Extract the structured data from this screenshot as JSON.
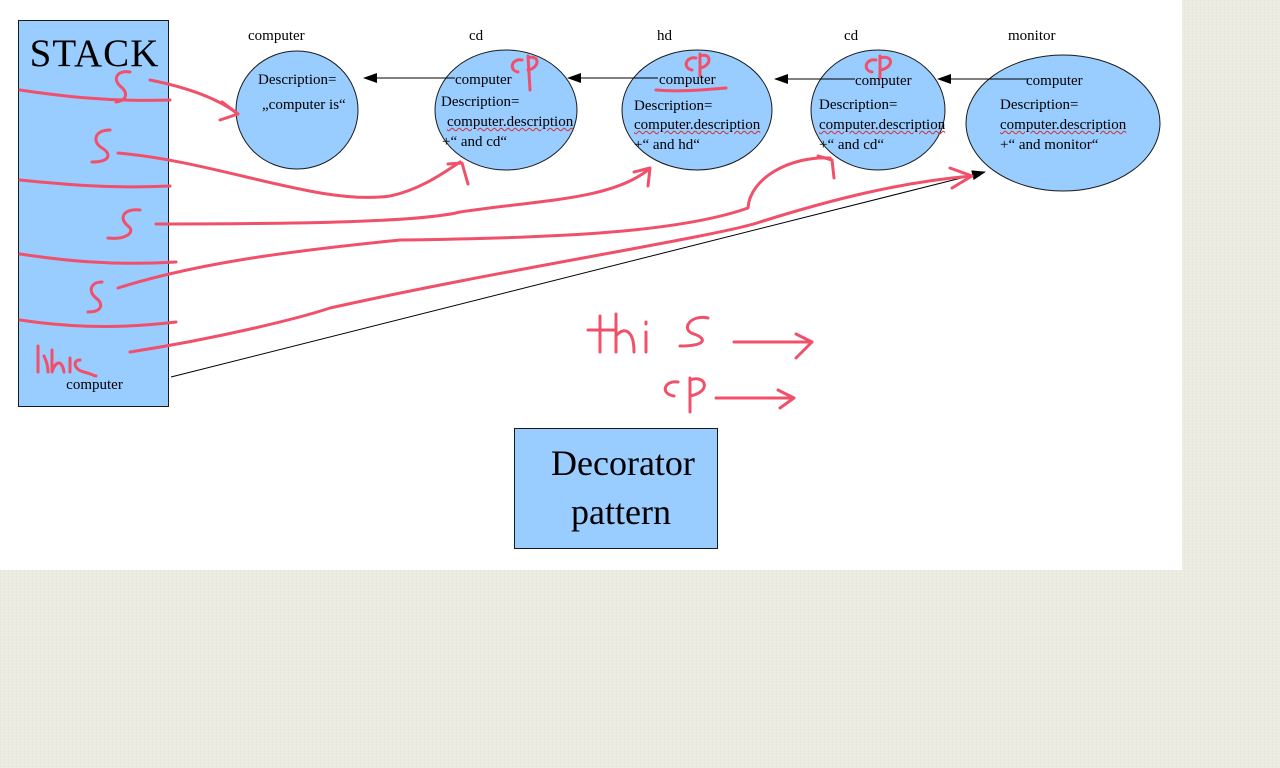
{
  "stack": {
    "title": "STACK",
    "bottom_label": "computer"
  },
  "decorator": {
    "line1": "Decorator",
    "line2": "pattern"
  },
  "nodes": [
    {
      "name": "computer",
      "lines": [
        "Description=",
        "„computer is“"
      ]
    },
    {
      "name": "cd",
      "top": "computer",
      "lines": [
        "Description=",
        "computer.description",
        "+“ and cd“"
      ]
    },
    {
      "name": "hd",
      "top": "computer",
      "lines": [
        "Description=",
        "computer.description",
        "+“ and hd“"
      ]
    },
    {
      "name": "cd",
      "top": "computer",
      "lines": [
        "Description=",
        "computer.description",
        "+“ and cd“"
      ]
    },
    {
      "name": "monitor",
      "top": "computer",
      "lines": [
        "Description=",
        "computer.description",
        "+“ and monitor“"
      ]
    }
  ],
  "handwriting": {
    "stack_marks": [
      "S",
      "S",
      "S",
      "S",
      "this"
    ],
    "cp": "cP",
    "legend_this": "thi S",
    "legend_cp": "cP"
  },
  "colors": {
    "box_fill": "#99ccff",
    "ink_red": "#f0506a"
  }
}
